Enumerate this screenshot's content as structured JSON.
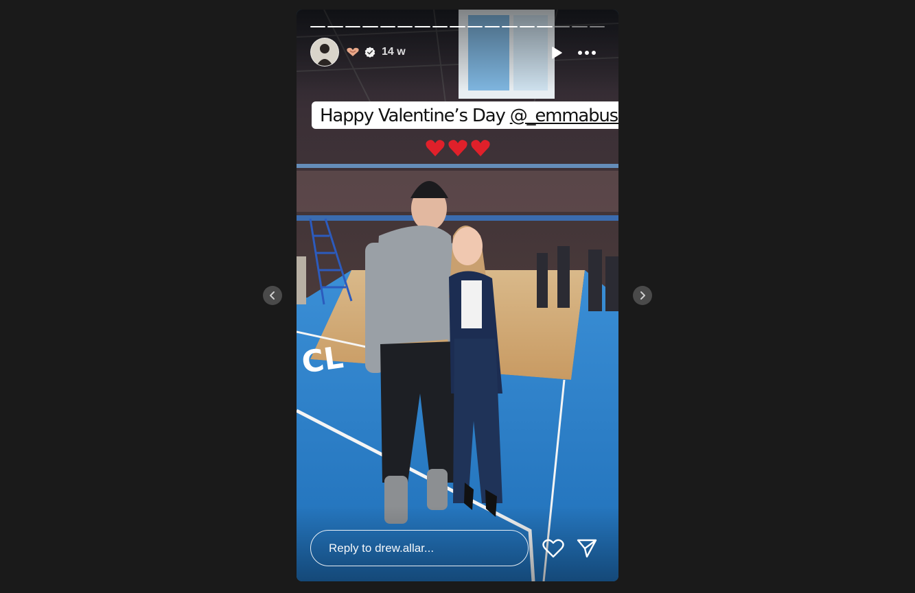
{
  "story": {
    "username_hint": "drew.allar",
    "posted_ago": "14 w",
    "progress": {
      "total_segments": 17,
      "current_segment": 14
    },
    "caption_text": "Happy Valentine’s Day ",
    "caption_mention": "@_emmabush_",
    "caption_emoji": "❤️❤️❤️"
  },
  "reply": {
    "placeholder": "Reply to drew.allar..."
  },
  "icons": {
    "prev": "chevron-left-icon",
    "next": "chevron-right-icon",
    "play": "play-icon",
    "more": "more-horizontal-icon",
    "like": "heart-outline-icon",
    "share": "send-icon",
    "verified": "verified-badge-icon",
    "emoji": "heart-hands-icon"
  },
  "colors": {
    "page_bg": "#1a1a1a",
    "court_blue": "#2a7fc8",
    "nav_button": "#4a4a4a",
    "caption_bg": "#ffffff",
    "heart_red": "#e0202a"
  }
}
